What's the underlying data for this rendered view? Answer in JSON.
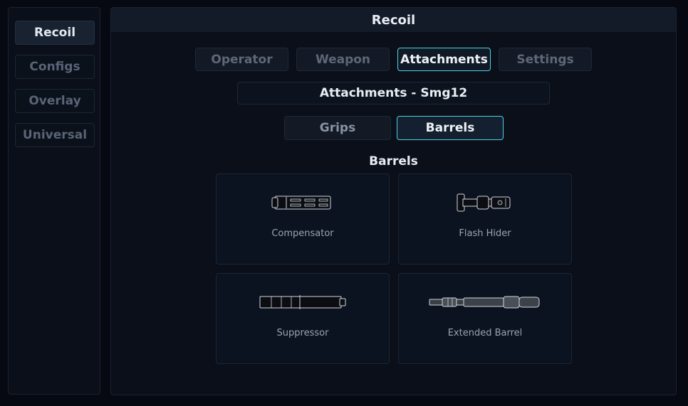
{
  "sidebar": {
    "items": [
      {
        "label": "Recoil",
        "active": true
      },
      {
        "label": "Configs",
        "active": false
      },
      {
        "label": "Overlay",
        "active": false
      },
      {
        "label": "Universal",
        "active": false
      }
    ]
  },
  "header": {
    "title": "Recoil"
  },
  "tabs": [
    {
      "label": "Operator",
      "active": false
    },
    {
      "label": "Weapon",
      "active": false
    },
    {
      "label": "Attachments",
      "active": true
    },
    {
      "label": "Settings",
      "active": false
    }
  ],
  "section": {
    "title": "Attachments - Smg12"
  },
  "subtabs": [
    {
      "label": "Grips",
      "active": false
    },
    {
      "label": "Barrels",
      "active": true
    }
  ],
  "list": {
    "heading": "Barrels",
    "items": [
      {
        "label": "Compensator",
        "icon": "compensator-icon"
      },
      {
        "label": "Flash Hider",
        "icon": "flash-hider-icon"
      },
      {
        "label": "Suppressor",
        "icon": "suppressor-icon"
      },
      {
        "label": "Extended Barrel",
        "icon": "extended-barrel-icon"
      }
    ]
  },
  "colors": {
    "accent": "#4fd1e0",
    "background": "#060912",
    "panel": "#0a0f1a",
    "header": "#131b29"
  }
}
